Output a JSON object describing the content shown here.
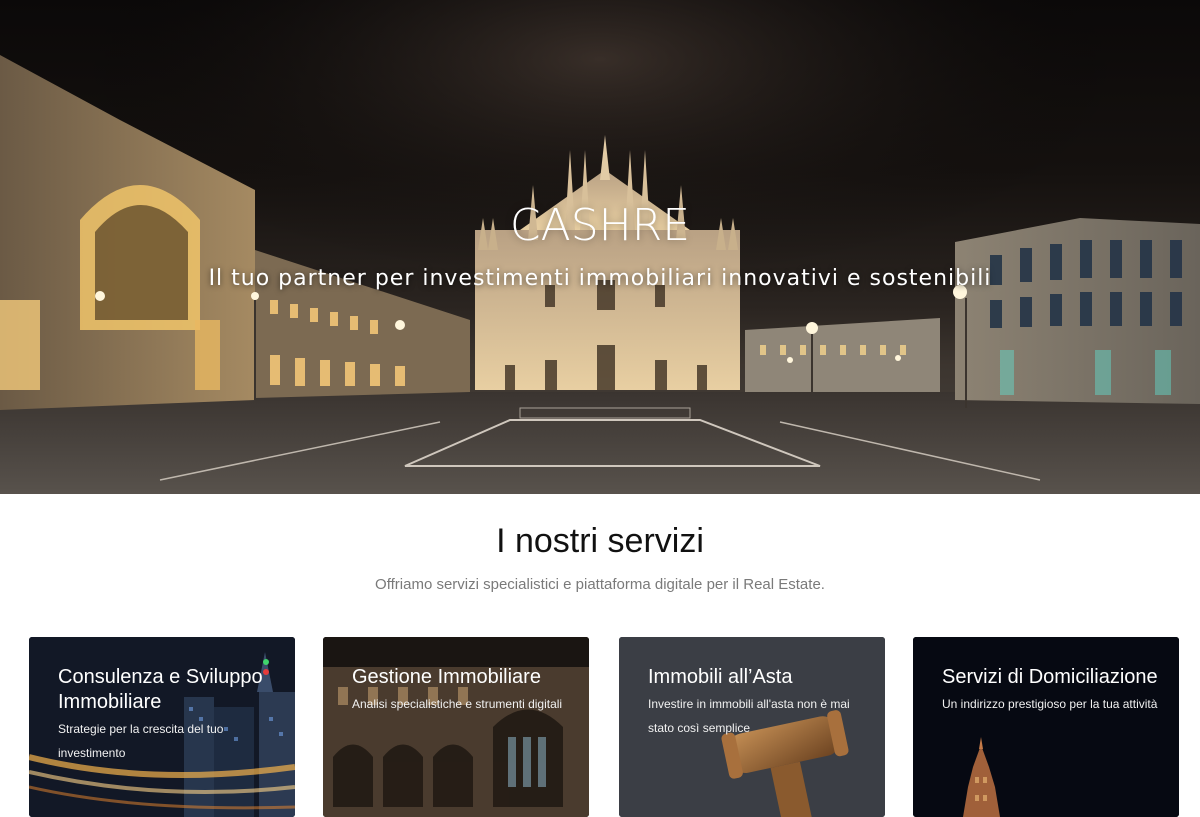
{
  "hero": {
    "title": "CASHRE",
    "subtitle": "Il tuo partner per investimenti immobiliari innovativi e sostenibili"
  },
  "services": {
    "title": "I nostri servizi",
    "subtitle": "Offriamo servizi specialistici e piattaforma digitale per il Real Estate.",
    "cards": [
      {
        "title": "Consulenza e Sviluppo Immobiliare",
        "description": "Strategie per la crescita del tuo investimento"
      },
      {
        "title": "Gestione Immobiliare",
        "description": "Analisi specialistiche e strumenti digitali"
      },
      {
        "title": "Immobili all’Asta",
        "description": "Investire in immobili all'asta non è mai stato così semplice"
      },
      {
        "title": "Servizi di Domiciliazione",
        "description": "Un indirizzo prestigioso per la tua attività"
      }
    ]
  }
}
